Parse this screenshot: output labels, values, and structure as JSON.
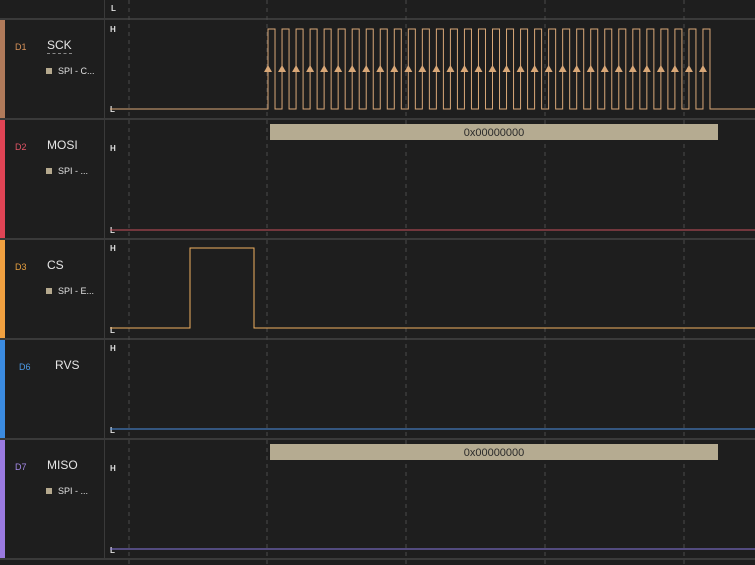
{
  "top_strip": {
    "level_label": "L"
  },
  "level_labels": {
    "high": "H",
    "low": "L"
  },
  "channels": [
    {
      "id": "D1",
      "name": "SCK",
      "analyzer": "SPI - C...",
      "color": "#b07a5a",
      "id_color": "#d9935a",
      "signal_color": "#d9a878"
    },
    {
      "id": "D2",
      "name": "MOSI",
      "analyzer": "SPI - ...",
      "color": "#e04455",
      "id_color": "#e25566",
      "signal_color": "#c8505c",
      "frame": "0x00000000"
    },
    {
      "id": "D3",
      "name": "CS",
      "analyzer": "SPI - E...",
      "color": "#f0a040",
      "id_color": "#e8a040",
      "signal_color": "#f0b060"
    },
    {
      "id": "D6",
      "name": "RVS",
      "analyzer": "",
      "color": "#3b8be0",
      "id_color": "#4d9be8",
      "signal_color": "#4a8ee0"
    },
    {
      "id": "D7",
      "name": "MISO",
      "analyzer": "SPI - ...",
      "color": "#9a7ae0",
      "id_color": "#a58ae8",
      "signal_color": "#8878e0",
      "frame": "0x00000000"
    }
  ],
  "sck_clock_edges": 32,
  "grid_color": "#4a4a4a"
}
